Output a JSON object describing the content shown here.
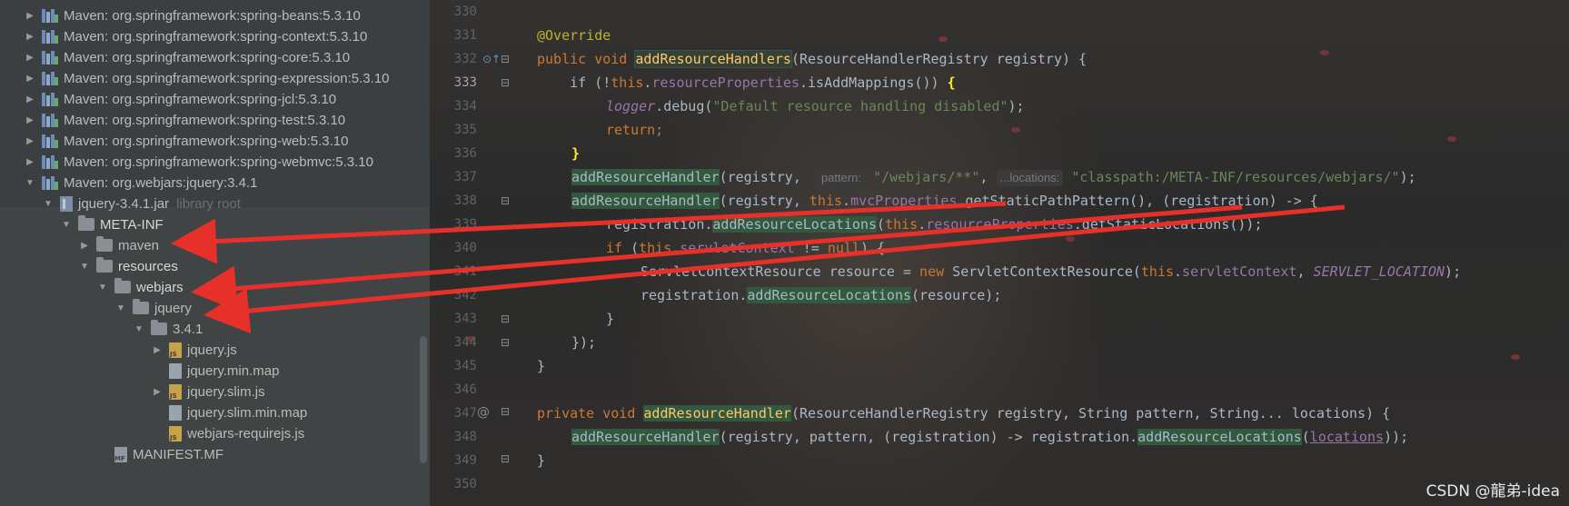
{
  "tree": {
    "rows": [
      {
        "label": "Maven: org.springframework:spring-beans:5.3.10",
        "icon": "library-icon"
      },
      {
        "label": "Maven: org.springframework:spring-context:5.3.10",
        "icon": "library-icon"
      },
      {
        "label": "Maven: org.springframework:spring-core:5.3.10",
        "icon": "library-icon"
      },
      {
        "label": "Maven: org.springframework:spring-expression:5.3.10",
        "icon": "library-icon"
      },
      {
        "label": "Maven: org.springframework:spring-jcl:5.3.10",
        "icon": "library-icon"
      },
      {
        "label": "Maven: org.springframework:spring-test:5.3.10",
        "icon": "library-icon"
      },
      {
        "label": "Maven: org.springframework:spring-web:5.3.10",
        "icon": "library-icon"
      },
      {
        "label": "Maven: org.springframework:spring-webmvc:5.3.10",
        "icon": "library-icon"
      },
      {
        "label": "Maven: org.webjars:jquery:3.4.1",
        "icon": "library-icon"
      },
      {
        "label": "jquery-3.4.1.jar",
        "suffix": "library root",
        "icon": "jar-icon"
      },
      {
        "label": "META-INF",
        "icon": "folder-icon"
      },
      {
        "label": "maven",
        "icon": "folder-icon"
      },
      {
        "label": "resources",
        "icon": "folder-icon"
      },
      {
        "label": "webjars",
        "icon": "folder-icon"
      },
      {
        "label": "jquery",
        "icon": "folder-icon"
      },
      {
        "label": "3.4.1",
        "icon": "folder-icon"
      },
      {
        "label": "jquery.js",
        "icon": "js-file-icon"
      },
      {
        "label": "jquery.min.map",
        "icon": "map-file-icon"
      },
      {
        "label": "jquery.slim.js",
        "icon": "js-file-icon"
      },
      {
        "label": "jquery.slim.min.map",
        "icon": "map-file-icon"
      },
      {
        "label": "webjars-requirejs.js",
        "icon": "js-file-icon"
      },
      {
        "label": "MANIFEST.MF",
        "icon": "manifest-file-icon"
      }
    ]
  },
  "editor": {
    "line_numbers": [
      "330",
      "331",
      "332",
      "333",
      "334",
      "335",
      "336",
      "337",
      "338",
      "339",
      "340",
      "341",
      "342",
      "343",
      "344",
      "345",
      "346",
      "347",
      "348",
      "349",
      "350"
    ],
    "current_line": "333",
    "code": {
      "l331": "@Override",
      "l332_kw": "public void ",
      "l332_fn": "addResourceHandlers",
      "l332_rest": "(ResourceHandlerRegistry registry) {",
      "l333_a": "    if (!",
      "l333_this": "this",
      "l333_b": ".",
      "l333_field": "resourceProperties",
      "l333_c": ".isAddMappings()) ",
      "l333_brace": "{",
      "l334_logger": "logger",
      "l334_a": ".debug(",
      "l334_str": "\"Default resource handling disabled\"",
      "l334_b": ");",
      "l335": "return;",
      "l336": "}",
      "l337_m": "addResourceHandler",
      "l337_a": "(registry,  ",
      "l337_hint1": "pattern:",
      "l337_s1": " \"/webjars/**\"",
      "l337_b": ", ",
      "l337_hint2": "...locations:",
      "l337_s2": " \"classpath:/META-INF/resources/webjars/\"",
      "l337_c": ");",
      "l338_m": "addResourceHandler",
      "l338_a": "(registry, ",
      "l338_this": "this",
      "l338_b": ".",
      "l338_field": "mvcProperties",
      "l338_c": ".getStaticPathPattern(), (registration) -> {",
      "l339_a": "registration.",
      "l339_m": "addResourceLocations",
      "l339_b": "(",
      "l339_this": "this",
      "l339_c": ".",
      "l339_field": "resourceProperties",
      "l339_d": ".getStaticLocations());",
      "l340_kw": "if",
      "l340_a": " (",
      "l340_this": "this",
      "l340_b": ".",
      "l340_field": "servletContext",
      "l340_c": " != ",
      "l340_null": "null",
      "l340_d": ") {",
      "l341_a": "ServletContextResource resource = ",
      "l341_new": "new",
      "l341_b": " ServletContextResource(",
      "l341_this": "this",
      "l341_c": ".",
      "l341_field": "servletContext",
      "l341_d": ", ",
      "l341_const": "SERVLET_LOCATION",
      "l341_e": ");",
      "l342_a": "registration.",
      "l342_m": "addResourceLocations",
      "l342_b": "(resource);",
      "l343": "}",
      "l344": "});",
      "l345": "}",
      "l347_kw": "private void ",
      "l347_fn": "addResourceHandler",
      "l347_rest": "(ResourceHandlerRegistry registry, String pattern, String... locations) {",
      "l348_m": "addResourceHandler",
      "l348_a": "(registry, pattern, (registration) -> registration.",
      "l348_m2": "addResourceLocations",
      "l348_b": "(",
      "l348_loc": "locations",
      "l348_c": "));",
      "l349": "}"
    }
  },
  "watermark": "CSDN @龍弟-idea",
  "colors": {
    "arrow": "#e8302a",
    "keyword": "#cc7832",
    "string": "#6a8759",
    "field": "#9876aa"
  }
}
